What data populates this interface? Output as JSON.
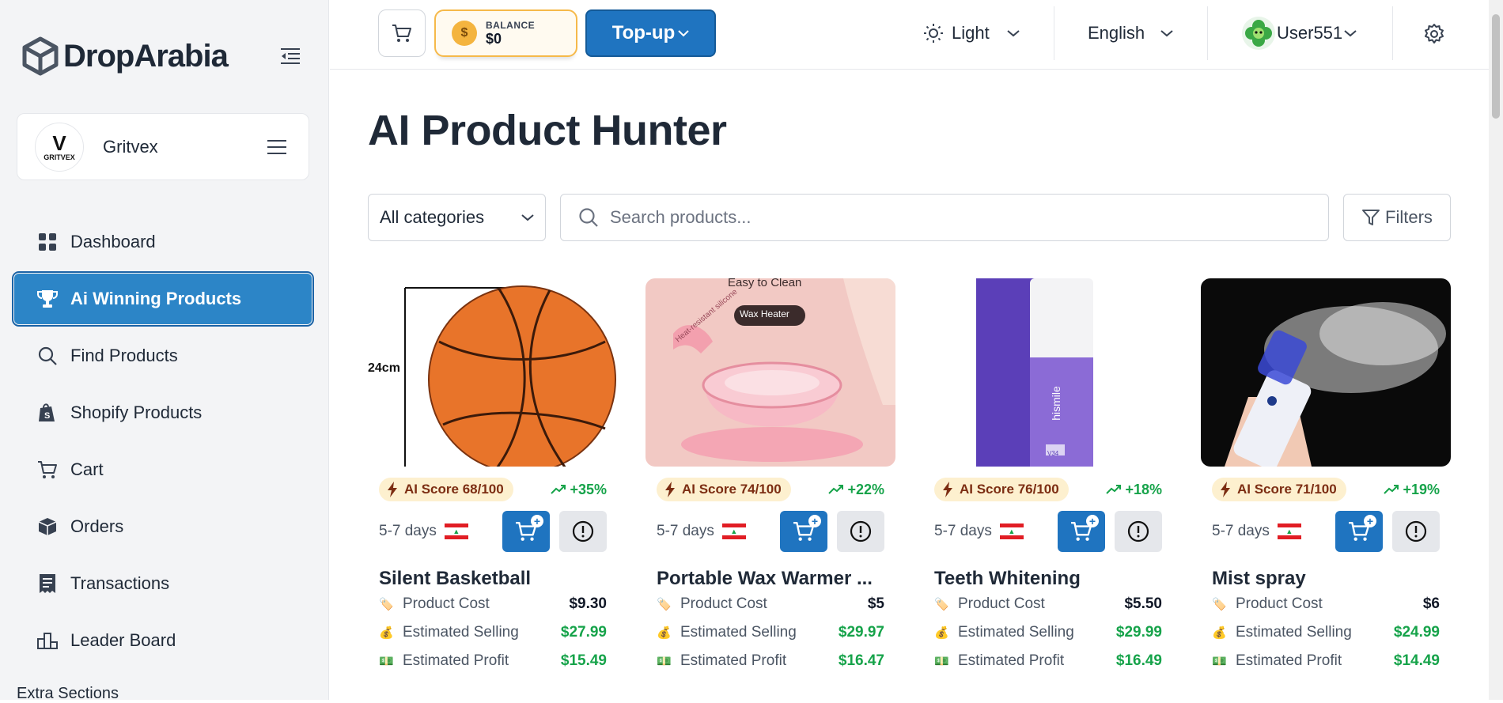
{
  "brand": {
    "name": "DropArabia"
  },
  "store": {
    "name": "Gritvex",
    "logo_text": "GRITVEX"
  },
  "nav": {
    "items": [
      {
        "label": "Dashboard",
        "icon": "grid-icon"
      },
      {
        "label": "Ai Winning Products",
        "icon": "trophy-icon",
        "active": true
      },
      {
        "label": "Find Products",
        "icon": "search-icon"
      },
      {
        "label": "Shopify Products",
        "icon": "shopify-bag-icon"
      },
      {
        "label": "Cart",
        "icon": "cart-icon"
      },
      {
        "label": "Orders",
        "icon": "box-icon"
      },
      {
        "label": "Transactions",
        "icon": "receipt-icon"
      },
      {
        "label": "Leader Board",
        "icon": "leaderboard-icon"
      }
    ],
    "extra_sections": "Extra Sections"
  },
  "header": {
    "balance_label": "BALANCE",
    "balance_value": "$0",
    "topup_label": "Top-up",
    "theme": "Light",
    "language": "English",
    "user": "User551"
  },
  "main": {
    "title": "AI Product Hunter",
    "category_select": "All categories",
    "search_placeholder": "Search products...",
    "filters_label": "Filters"
  },
  "labels": {
    "product_cost": "Product Cost",
    "estimated_selling": "Estimated Selling",
    "estimated_profit": "Estimated Profit"
  },
  "products": [
    {
      "title": "Silent Basketball",
      "score": "AI Score 68/100",
      "trend": "+35%",
      "shipping": "5-7 days",
      "cost": "$9.30",
      "selling": "$27.99",
      "profit": "$15.49",
      "image_text": "24cm"
    },
    {
      "title": "Portable Wax Warmer ...",
      "score": "AI Score 74/100",
      "trend": "+22%",
      "shipping": "5-7 days",
      "cost": "$5",
      "selling": "$29.97",
      "profit": "$16.47",
      "image_text": "Easy to Clean",
      "image_tag": "Wax Heater",
      "image_tag2": "Heat-resistant silicone"
    },
    {
      "title": "Teeth Whitening",
      "score": "AI Score 76/100",
      "trend": "+18%",
      "shipping": "5-7 days",
      "cost": "$5.50",
      "selling": "$29.99",
      "profit": "$16.49",
      "image_text": "hismile",
      "image_tag": "V34"
    },
    {
      "title": "Mist spray",
      "score": "AI Score 71/100",
      "trend": "+19%",
      "shipping": "5-7 days",
      "cost": "$6",
      "selling": "$24.99",
      "profit": "$14.49"
    }
  ],
  "colors": {
    "accent": "#2c85c7",
    "primary_button": "#1f74c0",
    "balance_border": "#f6b94a",
    "positive": "#16a34a",
    "score_bg": "#fdf0cf"
  }
}
